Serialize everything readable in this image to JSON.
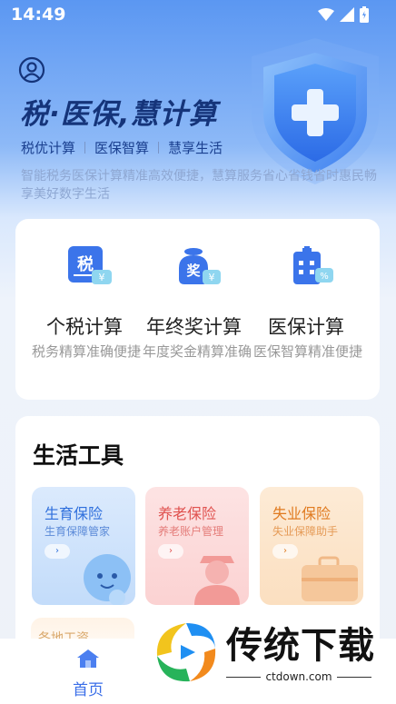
{
  "status_bar": {
    "time": "14:49"
  },
  "hero": {
    "title": "税·医保,慧计算",
    "tags": [
      "税优计算",
      "医保智算",
      "慧享生活"
    ],
    "description": "智能税务医保计算精准高效便捷，慧算服务省心省钱省时惠民畅享美好数字生活"
  },
  "calculators": [
    {
      "badge": "税",
      "name": "个税计算",
      "desc": "税务精算准确便捷"
    },
    {
      "badge": "奖",
      "name": "年终奖计算",
      "desc": "年度奖金精算准确"
    },
    {
      "badge": "",
      "name": "医保计算",
      "desc": "医保智算精准便捷"
    }
  ],
  "tools": {
    "title": "生活工具",
    "items": [
      {
        "title": "生育保险",
        "subtitle": "生育保障管家",
        "arrow": "›"
      },
      {
        "title": "养老保险",
        "subtitle": "养老账户管理",
        "arrow": "›"
      },
      {
        "title": "失业保险",
        "subtitle": "失业保障助手",
        "arrow": "›"
      }
    ],
    "more_label": "各地工资"
  },
  "nav": {
    "home_label": "首页"
  },
  "watermark": {
    "text": "传统下载",
    "url": "ctdown.com"
  },
  "colors": {
    "accent": "#3a6ee8",
    "title": "#15347a"
  }
}
